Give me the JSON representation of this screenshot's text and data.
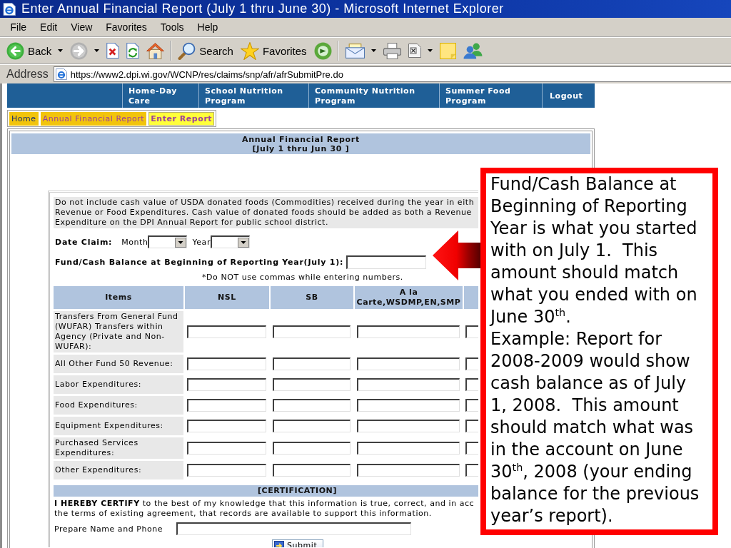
{
  "window": {
    "title": "Enter Annual Financial Report (July 1 thru June 30) - Microsoft Internet Explorer"
  },
  "menu": [
    "File",
    "Edit",
    "View",
    "Favorites",
    "Tools",
    "Help"
  ],
  "toolbar": [
    {
      "kind": "back",
      "label": "Back",
      "dropdown": true,
      "disabled": false
    },
    {
      "kind": "forward",
      "dropdown": true,
      "disabled": true
    },
    {
      "kind": "stop",
      "dropdown": false,
      "disabled": false
    },
    {
      "kind": "refresh",
      "dropdown": false,
      "disabled": false
    },
    {
      "kind": "home",
      "dropdown": false,
      "disabled": false
    },
    {
      "kind": "separator"
    },
    {
      "kind": "search",
      "label": "Search",
      "dropdown": false,
      "disabled": false
    },
    {
      "kind": "favorites",
      "label": "Favorites",
      "dropdown": false,
      "disabled": false
    },
    {
      "kind": "media",
      "dropdown": false,
      "disabled": false
    },
    {
      "kind": "separator"
    },
    {
      "kind": "mail",
      "dropdown": true,
      "disabled": false
    },
    {
      "kind": "print",
      "dropdown": false,
      "disabled": false
    },
    {
      "kind": "edit",
      "dropdown": true,
      "disabled": false
    },
    {
      "kind": "notes",
      "dropdown": false,
      "disabled": false
    },
    {
      "kind": "messenger",
      "dropdown": false,
      "disabled": false
    }
  ],
  "address_bar": {
    "label": "Address",
    "url": "https://www2.dpi.wi.gov/WCNP/res/claims/snp/afr/afrSubmitPre.do"
  },
  "nav": [
    {
      "lines": [
        "Home-Day",
        "Care"
      ]
    },
    {
      "lines": [
        "School Nutrition",
        "Program"
      ]
    },
    {
      "lines": [
        "Community Nutrition",
        "Program"
      ]
    },
    {
      "lines": [
        "Summer Food",
        "Program"
      ]
    },
    {
      "lines": [
        "Logout"
      ]
    }
  ],
  "breadcrumb": [
    {
      "label": "Home",
      "visited": false,
      "selected": false
    },
    {
      "label": "Annual Financial Report",
      "visited": true,
      "selected": false
    },
    {
      "label": "Enter Report",
      "visited": true,
      "selected": true
    }
  ],
  "report_header": {
    "title": "Annual Financial Report",
    "period": "[July 1 thru Jun 30 ]"
  },
  "form": {
    "note_lines": [
      "Do not include cash value of USDA donated foods (Commodities) received during the year in eith",
      "Revenue or Food Expenditures. Cash value of donated foods should be added as both a Revenue",
      "Expenditure on the DPI Annual Report for public school district."
    ],
    "date_claim": {
      "label": "Date Claim:",
      "month_label": "Month",
      "year_label": "Year"
    },
    "balance_label": "Fund/Cash Balance at Beginning of Reporting Year(July 1):",
    "hint": "*Do NOT use commas while entering numbers."
  },
  "table": {
    "columns": [
      {
        "kind": "item",
        "label": "Items"
      },
      {
        "kind": "amount",
        "label": "NSL"
      },
      {
        "kind": "amount",
        "label": "SB"
      },
      {
        "kind": "amount",
        "label": "A la Carte,WSDMP,EN,SMP"
      },
      {
        "kind": "amount"
      }
    ],
    "rows": [
      "Transfers From General Fund (WUFAR) Transfers within Agency (Private and Non-WUFAR):",
      "All Other Fund 50 Revenue:",
      "Labor Expenditures:",
      "Food Expenditures:",
      "Equipment Expenditures:",
      "Purchased Services Expenditures:",
      "Other Expenditures:"
    ]
  },
  "certification": {
    "title": "[CERTIFICATION]",
    "lines": [
      "**I HEREBY CERTIFY** to the best of my knowledge that this information is true, correct, and in acc",
      "the terms of existing agreement, that records are available to support this information."
    ],
    "name_label": "Prepare Name and Phone",
    "submit_label": "Submit"
  },
  "callout": {
    "paragraphs": [
      [
        "Fund/Cash Balance at",
        "Beginning of Reporting",
        "Year is what you started",
        "with on July 1.  This",
        "amount should match",
        "what you ended with on",
        "June 30$^{th}$."
      ],
      [
        "Example: Report for",
        "2008-2009 would show",
        "cash balance as of July",
        "1, 2008.  This amount",
        "should match what was",
        "in the account on June",
        "30$^{th}$, 2008 (your ending",
        "balance for the previous",
        "year’s report)."
      ]
    ]
  }
}
